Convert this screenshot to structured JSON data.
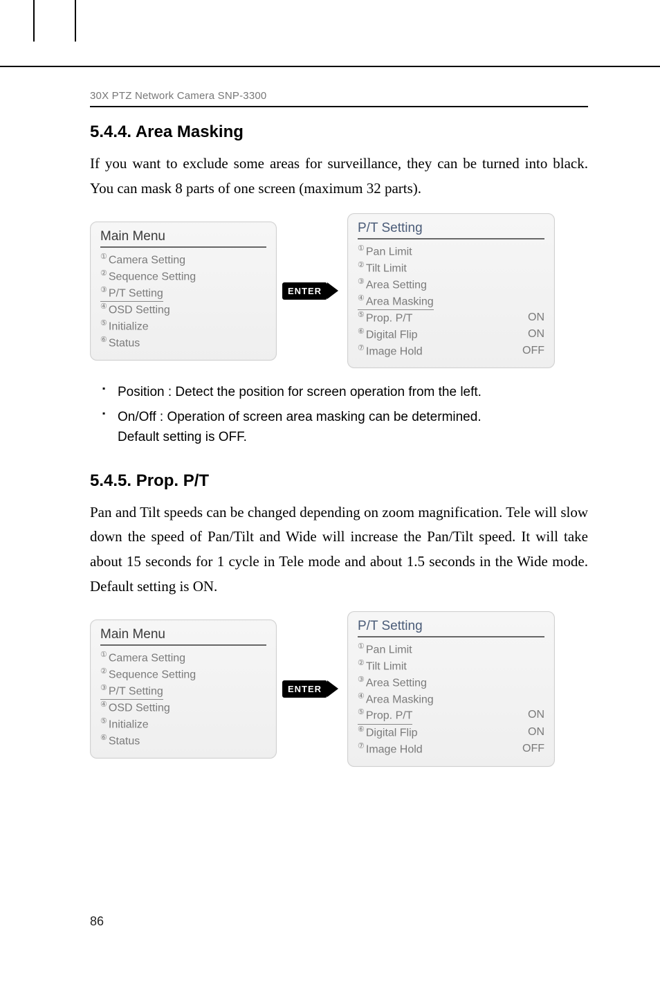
{
  "header": {
    "running": "30X PTZ Network Camera SNP-3300"
  },
  "section_a": {
    "heading": "5.4.4. Area Masking",
    "paragraph": "If you want to exclude some areas for surveillance, they can be turned into black. You can mask 8 parts of one screen (maximum 32 parts).",
    "osd": {
      "left_title": "Main Menu",
      "left_items": [
        "Camera Setting",
        "Sequence Setting",
        "P/T Setting",
        "OSD Setting",
        "Initialize",
        "Status"
      ],
      "left_highlight_index": 2,
      "enter_label": "ENTER",
      "right_title": "P/T Setting",
      "right_items": [
        {
          "label": "Pan Limit",
          "value": ""
        },
        {
          "label": "Tilt Limit",
          "value": ""
        },
        {
          "label": "Area Setting",
          "value": ""
        },
        {
          "label": "Area Masking",
          "value": ""
        },
        {
          "label": "Prop. P/T",
          "value": "ON"
        },
        {
          "label": "Digital Flip",
          "value": "ON"
        },
        {
          "label": "Image Hold",
          "value": "OFF"
        }
      ],
      "right_highlight_index": 3
    },
    "bullets": [
      {
        "line1": "Position : Detect the position for screen operation from the left.",
        "line2": ""
      },
      {
        "line1": "On/Off : Operation of screen area masking can be determined.",
        "line2": "Default setting is OFF."
      }
    ]
  },
  "section_b": {
    "heading": "5.4.5. Prop. P/T",
    "paragraph": "Pan and Tilt speeds can be changed depending on zoom magnification. Tele will slow down the speed of Pan/Tilt and Wide will increase the Pan/Tilt speed. It will take about 15 seconds for 1 cycle in Tele mode and about 1.5 seconds in the Wide mode. Default setting is ON.",
    "osd": {
      "left_title": "Main Menu",
      "left_items": [
        "Camera Setting",
        "Sequence Setting",
        "P/T Setting",
        "OSD Setting",
        "Initialize",
        "Status"
      ],
      "left_highlight_index": 2,
      "enter_label": "ENTER",
      "right_title": "P/T Setting",
      "right_items": [
        {
          "label": "Pan Limit",
          "value": ""
        },
        {
          "label": "Tilt Limit",
          "value": ""
        },
        {
          "label": "Area Setting",
          "value": ""
        },
        {
          "label": "Area Masking",
          "value": ""
        },
        {
          "label": "Prop. P/T",
          "value": "ON"
        },
        {
          "label": "Digital Flip",
          "value": "ON"
        },
        {
          "label": "Image Hold",
          "value": "OFF"
        }
      ],
      "right_highlight_index": 4
    }
  },
  "page_number": "86",
  "markers": {
    "circled": [
      "①",
      "②",
      "③",
      "④",
      "⑤",
      "⑥",
      "⑦"
    ]
  }
}
